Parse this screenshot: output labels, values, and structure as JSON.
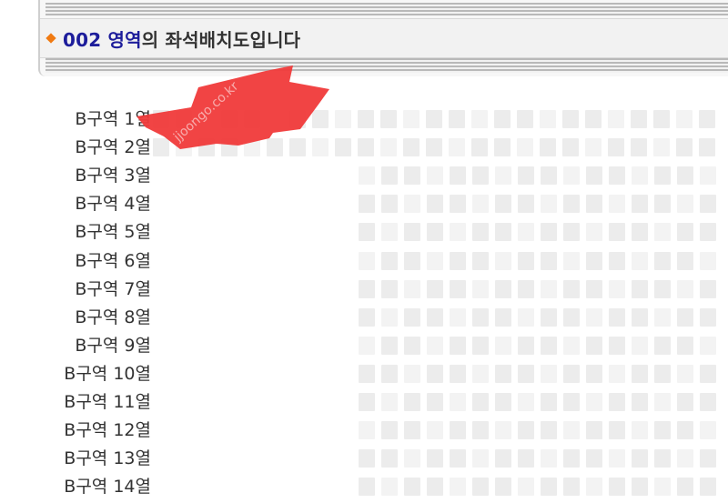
{
  "header": {
    "zone_name": "002 영역",
    "title_suffix": "의 좌석배치도입니다"
  },
  "seat_map": {
    "rows": [
      {
        "label": "B구역 1열"
      },
      {
        "label": "B구역 2열"
      },
      {
        "label": "B구역 3열"
      },
      {
        "label": "B구역 4열"
      },
      {
        "label": "B구역 5열"
      },
      {
        "label": "B구역 6열"
      },
      {
        "label": "B구역 7열"
      },
      {
        "label": "B구역 8열"
      },
      {
        "label": "B구역 9열"
      },
      {
        "label": "B구역 10열"
      },
      {
        "label": "B구역 11열"
      },
      {
        "label": "B구역 12열"
      },
      {
        "label": "B구역 13열"
      },
      {
        "label": "B구역 14열"
      }
    ],
    "seat_color": "#ececec"
  },
  "overlay": {
    "marker_color": "#f03a3a",
    "watermark": "jjoongo.co.kr"
  }
}
